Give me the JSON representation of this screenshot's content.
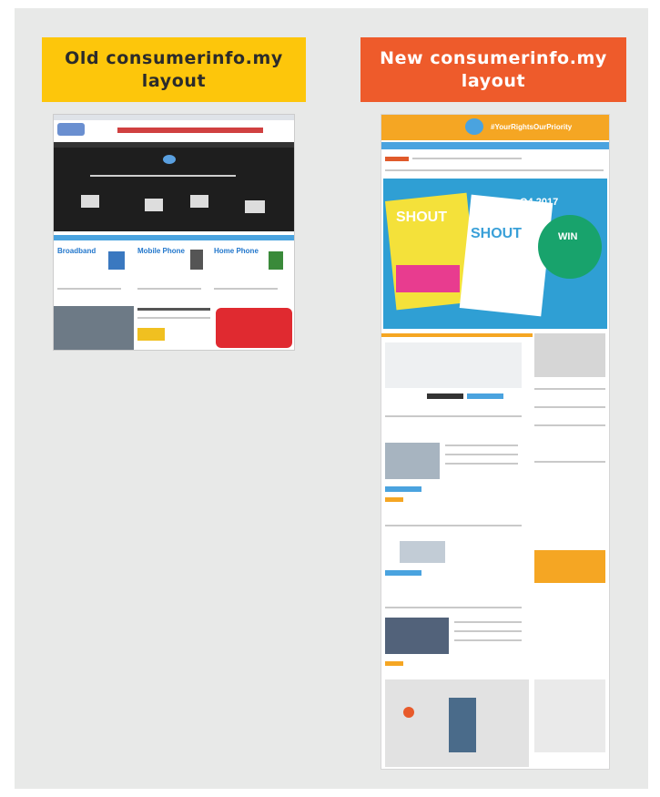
{
  "labels": {
    "old_title": "Old consumerinfo.my\nlayout",
    "new_title": "New consumerinfo.my\nlayout"
  },
  "colors": {
    "panel_bg": "#e8e9e8",
    "old_label_bg": "#fdc60b",
    "new_label_bg": "#ee5b2b",
    "new_site_accent": "#f5a623",
    "old_site_dark": "#1e1e1e"
  },
  "old_site": {
    "categories": [
      "Broadband",
      "Mobile Phone",
      "Home Phone"
    ]
  },
  "new_site": {
    "hashtag": "#YourRightsOurPriority",
    "badge": "Q4 2017",
    "magazine": "SHOUT",
    "promo_word": "WIN"
  }
}
